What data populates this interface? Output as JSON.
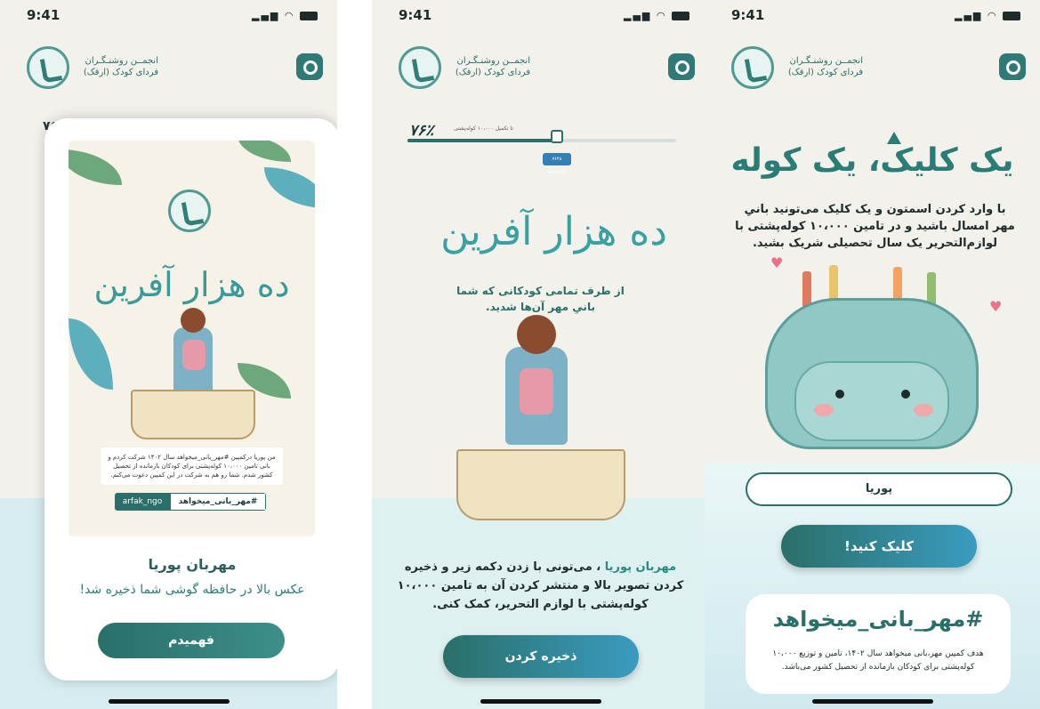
{
  "status": {
    "time": "9:41"
  },
  "org": {
    "name_line1": "انجمــن روشنـگـران",
    "name_line2": "فردای کودک (ارفک)"
  },
  "panel1": {
    "peek_text": "۷۶",
    "poster": {
      "title": "ده هزار آفرین",
      "message": "من پوریا درکمپین #مهر_بانی_میخواهد سال ۱۴۰۲ شرکت کردم و بانی تامین ۱۰،۰۰۰ کوله‌پشتی برای کودکان بازمانده از تحصیل کشور شدم. شما رو هم به شرکت در این کمپین دعوت می‌کنم.",
      "hashtag": "#مهر_بانی_میخواهد",
      "instagram": "arfak_ngo"
    },
    "card_name": "مهربان پوریا",
    "card_message": "عکس بالا در حافظه گوشی شما ذخیره شد!",
    "button_label": "فهمیدم"
  },
  "panel2": {
    "progress_percent_label": "۷۶٪",
    "progress_value": 0.55,
    "progress_caption": "تا تکمیل ۱۰،۰۰۰ کوله‌پشتی",
    "milestone_tip": "۷۶۴۸ کوله‌پشتی",
    "title": "ده هزار آفرین",
    "subtitle": "از طرف تمامی کودکانی که شما بانیِ مهر آن‌ها شدید.",
    "message_name": "مهربان پوریا",
    "message_body": "، می‌تونی با زدن دکمه زیر و ذخیره کردن تصویر بالا و منتشر کردن آن به تامین ۱۰،۰۰۰ کوله‌پشتی با لوازم التحریر، کمک کنی.",
    "button_label": "ذخیره کردن"
  },
  "panel3": {
    "title": "یک کلیک، یک کوله",
    "subtitle": "با وارد کردن اسمتون و یک کلیک می‌تونید بانیِ مهر امسال باشید و در تامین ۱۰،۰۰۰ کوله‌پشتی با لوازم‌التحریر یک سال تحصیلی شریک بشید.",
    "name_value": "پوریا",
    "button_label": "کلیک کنید!",
    "info_hashtag": "#مهر_بانی_میخواهد",
    "info_desc": "هدف کمپین مهر،بانی میخواهد سال ۱۴۰۲، تامین و توزیع ۱۰،۰۰۰ کوله‌پشتی برای کودکان بازمانده از تحصیل کشور می‌باشد."
  }
}
